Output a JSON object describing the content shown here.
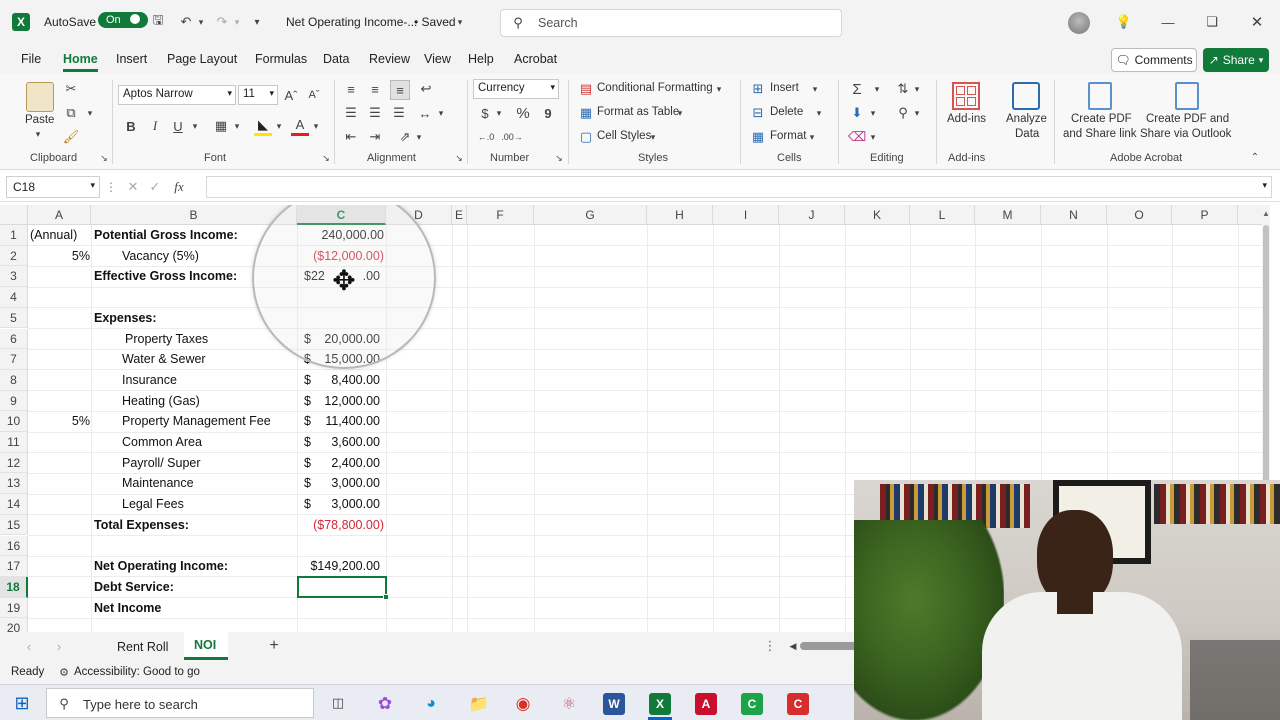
{
  "titlebar": {
    "autosave_label": "AutoSave",
    "autosave_state": "On",
    "doc_title": "Net Operating Income-...",
    "saved_status": "• Saved",
    "search_placeholder": "Search"
  },
  "menu": {
    "items": [
      "File",
      "Home",
      "Insert",
      "Page Layout",
      "Formulas",
      "Data",
      "Review",
      "View",
      "Help",
      "Acrobat"
    ],
    "active": "Home",
    "comments_label": "Comments",
    "share_label": "Share"
  },
  "ribbon": {
    "paste_label": "Paste",
    "font_name": "Aptos Narrow",
    "font_size": "11",
    "number_format": "Currency",
    "conditional_formatting": "Conditional Formatting",
    "format_as_table": "Format as Table",
    "cell_styles": "Cell Styles",
    "insert": "Insert",
    "delete": "Delete",
    "format": "Format",
    "add_ins": "Add-ins",
    "analyze_data_1": "Analyze",
    "analyze_data_2": "Data",
    "create_pdf_link_1": "Create PDF",
    "create_pdf_link_2": "and Share link",
    "create_pdf_outlook_1": "Create PDF and",
    "create_pdf_outlook_2": "Share via Outlook",
    "groups": {
      "clipboard": "Clipboard",
      "font": "Font",
      "alignment": "Alignment",
      "number": "Number",
      "styles": "Styles",
      "cells": "Cells",
      "editing": "Editing",
      "addins": "Add-ins",
      "acrobat": "Adobe Acrobat"
    },
    "percent_symbol": "%",
    "comma_symbol": "9",
    "dollar_symbol": "$"
  },
  "formula_bar": {
    "name_box": "C18",
    "fx": "fx",
    "value": ""
  },
  "columns": [
    "A",
    "B",
    "C",
    "D",
    "E",
    "F",
    "G",
    "H",
    "I",
    "J",
    "K",
    "L",
    "M",
    "N",
    "O",
    "P"
  ],
  "rows": [
    "1",
    "2",
    "3",
    "4",
    "5",
    "6",
    "7",
    "8",
    "9",
    "10",
    "11",
    "12",
    "13",
    "14",
    "15",
    "16",
    "17",
    "18",
    "19",
    "20"
  ],
  "cells": {
    "A1": "(Annual)",
    "B1": "Potential Gross Income:",
    "C1": "240,000.00",
    "A2": "5%",
    "B2": "Vacancy (5%)",
    "C2": "($12,000.00)",
    "B3": "Effective Gross Income:",
    "C3a": "$22",
    "C3b": ".00",
    "B5": "Expenses:",
    "B6": "Property Taxes",
    "C6": "20,000.00",
    "B7": "Water & Sewer",
    "C7": "15,000.00",
    "B8": "Insurance",
    "C8": "8,400.00",
    "B9": "Heating (Gas)",
    "C9": "12,000.00",
    "A10": "5%",
    "B10": "Property Management Fee",
    "C10": "11,400.00",
    "B11": "Common Area",
    "C11": "3,600.00",
    "B12": "Payroll/ Super",
    "C12": "2,400.00",
    "B13": "Maintenance",
    "C13": "3,000.00",
    "B14": "Legal Fees",
    "C14": "3,000.00",
    "B15": "Total Expenses:",
    "C15": "($78,800.00)",
    "B17": "Net Operating Income:",
    "C17": "$149,200.00",
    "B18": "Debt Service:",
    "B19": "Net Income",
    "dollar": "$"
  },
  "sheets": {
    "tabs": [
      "Rent Roll",
      "NOI"
    ],
    "active": "NOI",
    "add_symbol": "+"
  },
  "status": {
    "ready": "Ready",
    "accessibility": "Accessibility: Good to go"
  },
  "taskbar": {
    "search_placeholder": "Type here to search"
  },
  "colors": {
    "excel_green": "#117a3a",
    "negative_red": "#d0263a"
  }
}
